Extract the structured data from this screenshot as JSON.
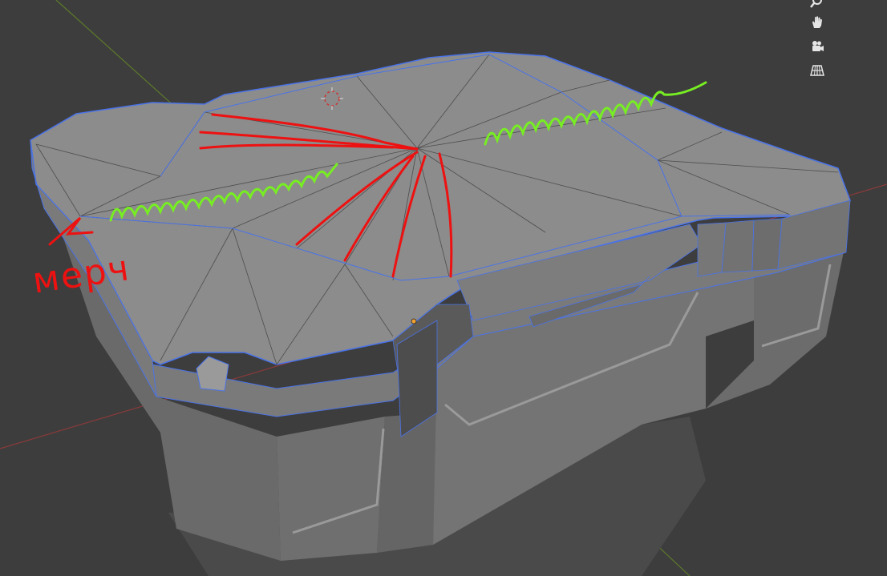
{
  "viewport": {
    "background_color": "#3d3d3d",
    "grid_axis_x_color": "#9a3b3b",
    "grid_axis_y_color": "#6f8a2e",
    "wire_color": "#4a73e8",
    "mesh_face_color": "#8c8c8c",
    "mesh_side_color": "#6e6e6e",
    "mesh_dark_color": "#555555"
  },
  "navigation": {
    "icons": [
      "zoom-icon",
      "pan-hand-icon",
      "camera-view-icon",
      "ortho-grid-icon"
    ]
  },
  "annotations": {
    "handwritten_label": "мерч",
    "red_stroke_color": "#ee1111",
    "green_stroke_color": "#77ee22"
  }
}
